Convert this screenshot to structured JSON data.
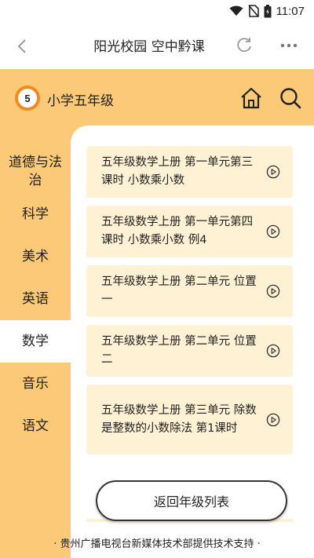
{
  "status_bar": {
    "time": "11:07",
    "icons": [
      "wifi-icon",
      "no-sim-icon",
      "battery-icon"
    ]
  },
  "app_bar": {
    "title": "阳光校园 空中黔课",
    "icons": [
      "back-arrow-icon",
      "refresh-icon",
      "more-icon"
    ]
  },
  "header": {
    "grade_number": "5",
    "grade_title": "小学五年级",
    "icons": [
      "home-icon",
      "search-icon"
    ]
  },
  "sidebar": {
    "items": [
      {
        "label": "道德与法治",
        "active": false
      },
      {
        "label": "科学",
        "active": false
      },
      {
        "label": "美术",
        "active": false
      },
      {
        "label": "英语",
        "active": false
      },
      {
        "label": "数学",
        "active": true
      },
      {
        "label": "音乐",
        "active": false
      },
      {
        "label": "语文",
        "active": false
      }
    ]
  },
  "lessons": [
    {
      "title": "五年级数学上册 第一单元第三课时 小数乘小数",
      "icon": "play-circle-icon"
    },
    {
      "title": "五年级数学上册 第一单元第四课时 小数乘小数 例4",
      "icon": "play-circle-icon"
    },
    {
      "title": "五年级数学上册 第二单元 位置 一",
      "icon": "play-circle-icon"
    },
    {
      "title": "五年级数学上册 第二单元 位置 二",
      "icon": "play-circle-icon"
    },
    {
      "title": "五年级数学上册 第三单元 除数是整数的小数除法 第1课时",
      "icon": "play-circle-icon"
    }
  ],
  "back_button_label": "返回年级列表",
  "footer": "· 贵州广播电视台新媒体技术部提供技术支持 ·",
  "colors": {
    "accent": "#fcc976",
    "badge_ring": "#f08a24",
    "card_bg": "#fff1d4"
  }
}
